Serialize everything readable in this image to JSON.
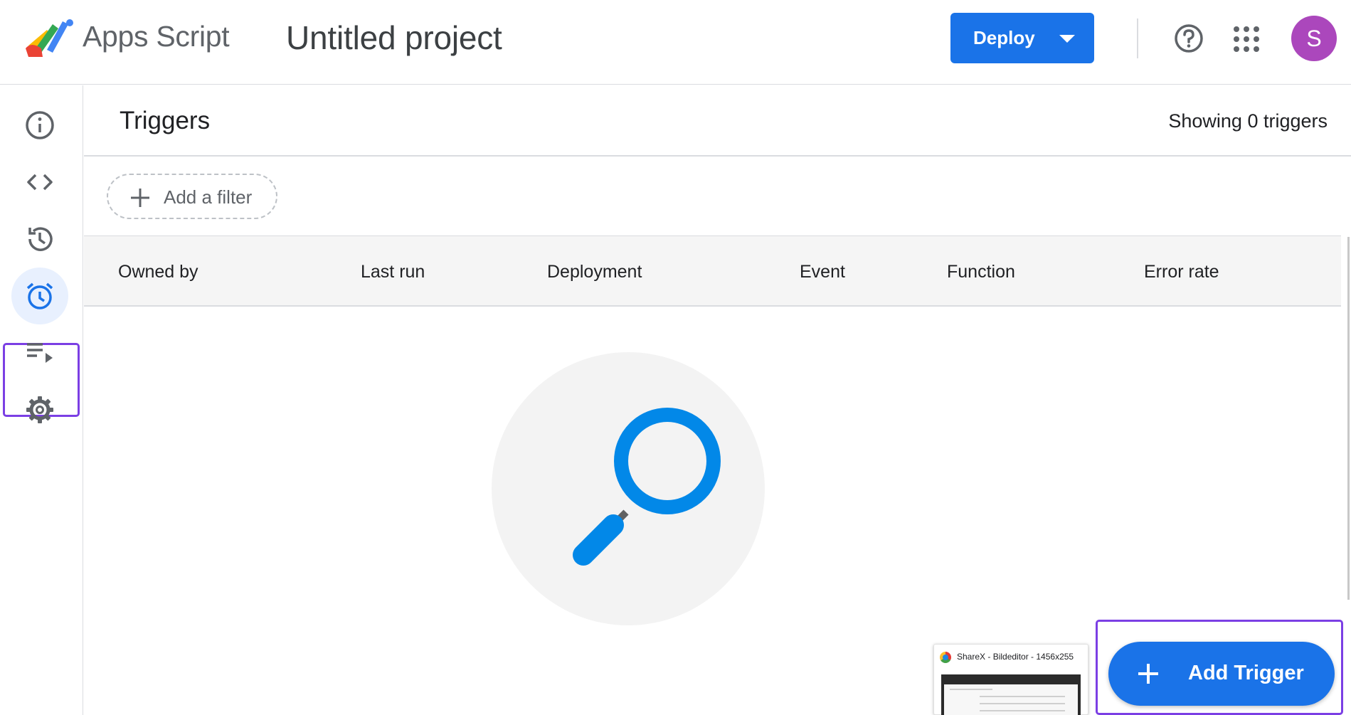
{
  "header": {
    "app_name": "Apps Script",
    "project_title": "Untitled project",
    "deploy_label": "Deploy",
    "avatar_initial": "S"
  },
  "sidebar": {
    "items": [
      {
        "name": "overview",
        "icon": "info-icon",
        "active": false
      },
      {
        "name": "editor",
        "icon": "code-icon",
        "active": false
      },
      {
        "name": "project-history",
        "icon": "history-icon",
        "active": false
      },
      {
        "name": "triggers",
        "icon": "alarm-icon",
        "active": true
      },
      {
        "name": "executions",
        "icon": "playlist-play-icon",
        "active": false
      },
      {
        "name": "settings",
        "icon": "gear-icon",
        "active": false
      }
    ]
  },
  "main": {
    "title": "Triggers",
    "count_text": "Showing 0 triggers",
    "filter_label": "Add a filter",
    "columns": [
      "Owned by",
      "Last run",
      "Deployment",
      "Event",
      "Function",
      "Error rate"
    ]
  },
  "popup": {
    "title": "ShareX - Bildeditor - 1456x255"
  },
  "fab": {
    "label": "Add Trigger"
  },
  "colors": {
    "primary": "#1a73e8",
    "avatar": "#ab47bc",
    "highlight": "#7b3fe4",
    "magnifier": "#0288e8"
  }
}
